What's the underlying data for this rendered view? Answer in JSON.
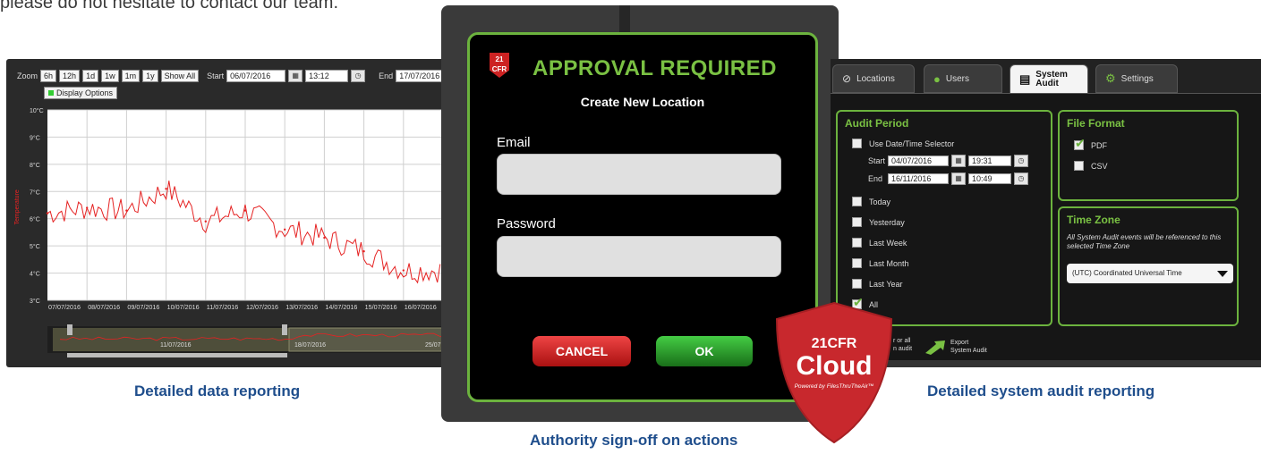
{
  "intro_text": "please do not hesitate to contact our team.",
  "captions": {
    "left": "Detailed data reporting",
    "middle": "Authority sign-off on actions",
    "right": "Detailed system audit reporting"
  },
  "chart_panel": {
    "zoom_label": "Zoom",
    "zoom_buttons": [
      "6h",
      "12h",
      "1d",
      "1w",
      "1m",
      "1y",
      "Show All"
    ],
    "start_label": "Start",
    "start_date": "06/07/2016",
    "start_time": "13:12",
    "end_label": "End",
    "end_date": "17/07/2016",
    "display_options": "Display Options",
    "ylabel": "Temperature",
    "yticks": [
      "10°C",
      "9°C",
      "8°C",
      "7°C",
      "6°C",
      "5°C",
      "4°C",
      "3°C"
    ],
    "xticks": [
      "07/07/2016",
      "08/07/2016",
      "09/07/2016",
      "10/07/2016",
      "11/07/2016",
      "12/07/2016",
      "13/07/2016",
      "14/07/2016",
      "15/07/2016",
      "16/07/2016"
    ],
    "nav_dates": [
      "11/07/2016",
      "18/07/2016",
      "25/07"
    ],
    "accent": "#e52222"
  },
  "chart_data": {
    "type": "line",
    "title": "",
    "xlabel": "",
    "ylabel": "Temperature",
    "ylim": [
      3,
      10
    ],
    "x": [
      "07/07/2016",
      "08/07/2016",
      "09/07/2016",
      "10/07/2016",
      "11/07/2016",
      "12/07/2016",
      "13/07/2016",
      "14/07/2016",
      "15/07/2016",
      "16/07/2016"
    ],
    "series": [
      {
        "values": [
          6.2,
          6.4,
          6.3,
          7.1,
          5.9,
          6.3,
          5.6,
          5.3,
          4.8,
          4.1
        ]
      }
    ]
  },
  "modal": {
    "badge_top": "21",
    "badge_bottom": "CFR",
    "title": "APPROVAL REQUIRED",
    "subtitle": "Create New Location",
    "email_label": "Email",
    "password_label": "Password",
    "cancel": "CANCEL",
    "ok": "OK"
  },
  "right_panel": {
    "tabs": [
      "Locations",
      "Users",
      "System Audit",
      "Settings"
    ],
    "audit_period_title": "Audit Period",
    "use_selector": "Use Date/Time Selector",
    "start_label": "Start",
    "start_date": "04/07/2016",
    "start_time": "19:31",
    "end_label": "End",
    "end_date": "16/11/2016",
    "end_time": "10:49",
    "periods": [
      "Today",
      "Yesterday",
      "Last Week",
      "Last Month",
      "Last Year",
      "All"
    ],
    "file_format_title": "File Format",
    "formats": [
      "PDF",
      "CSV"
    ],
    "time_zone_title": "Time Zone",
    "time_zone_note": "All System Audit events will be referenced to this selected Time Zone",
    "time_zone_value": "(UTC) Coordinated Universal Time",
    "partial_text": "r or all\nn audit",
    "export_label": "Export\nSystem Audit"
  },
  "shield": {
    "top": "21CFR",
    "main": "Cloud",
    "tagline": "Powered by FilesThruTheAir™",
    "color": "#c8282d"
  }
}
